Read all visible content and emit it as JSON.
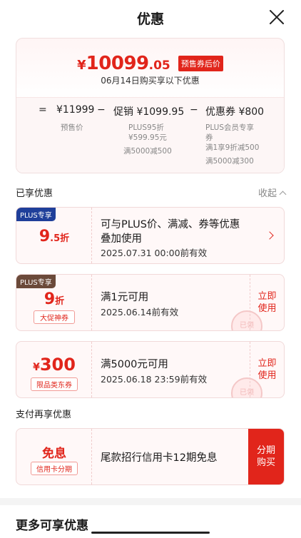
{
  "header": {
    "title": "优惠",
    "close_icon": "close-icon"
  },
  "summary": {
    "price_yen": "¥",
    "price_int": "10099",
    "price_dec": ".05",
    "badge": "预售券后价",
    "date_text": "06月14日购买享以下优惠",
    "eq": "=",
    "presale_price": "¥11999",
    "minus1": "−",
    "promo_amount": "促销 ¥1099.95",
    "minus2": "−",
    "coupon_amount": "优惠券 ¥800",
    "presale_label": "预售价",
    "promo_sub1": "PLUS95折",
    "promo_sub2": "¥599.95元",
    "promo_sub3": "满5000减500",
    "coupon_sub1": "PLUS会员专享",
    "coupon_sub2": "券",
    "coupon_sub3": "满1享9折减500",
    "coupon_sub4": "满5000减300"
  },
  "enjoyed": {
    "label": "已享优惠",
    "collapse_label": "收起"
  },
  "coupons": [
    {
      "tag": "PLUS专享",
      "value_main": "9",
      "value_sub": ".5折",
      "title": "可与PLUS价、满减、券等优惠",
      "title2": "叠加使用",
      "date": "2025.07.31 00:00前有效"
    },
    {
      "tag": "PLUS专享",
      "value_main": "9",
      "value_sub": "折",
      "badge": "大促神券",
      "title": "满1元可用",
      "date": "2025.06.14前有效",
      "action": "立即\n使用",
      "action1": "立即",
      "action2": "使用",
      "stamp": "已领"
    },
    {
      "value_yen": "¥",
      "value_main": "300",
      "badge": "限品类东券",
      "title": "满5000元可用",
      "date": "2025.06.18 23:59前有效",
      "action1": "立即",
      "action2": "使用",
      "stamp": "已领"
    }
  ],
  "payment": {
    "label": "支付再享优惠",
    "left_title": "免息",
    "left_badge": "信用卡分期",
    "title": "尾款招行信用卡12期免息",
    "button1": "分期",
    "button2": "购买"
  },
  "more": {
    "title": "更多可享优惠"
  },
  "colors": {
    "accent": "#e1251b",
    "plus_blue": "#1f3f9a",
    "plus_brown": "#6b4a3a"
  }
}
